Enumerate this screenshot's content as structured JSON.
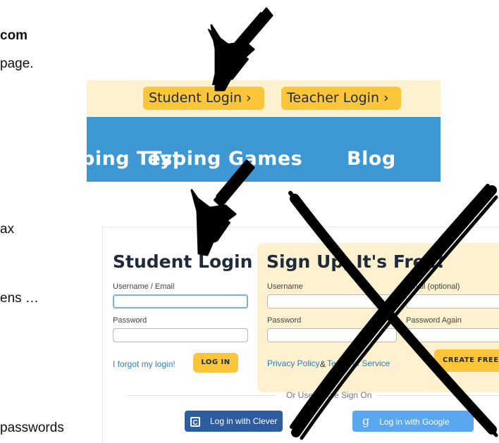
{
  "doc": {
    "line1": "com",
    "line2": "page.",
    "line3": "ax",
    "line4": "ens …",
    "line5": "passwords"
  },
  "topnav": {
    "student_login": "Student Login ›",
    "teacher_login": "Teacher Login ›",
    "links": [
      "ping Test",
      "Typing Games",
      "Blog"
    ]
  },
  "login": {
    "title": "Student Login",
    "username_label": "Username / Email",
    "password_label": "Password",
    "forgot_link": "I forgot my login!",
    "login_button": "LOG IN"
  },
  "signup": {
    "title": "Sign Up, It's Free!",
    "username_label": "Username",
    "email_label": "Email (optional)",
    "password_label": "Password",
    "password_again_label": "Password Again",
    "privacy_link": "Privacy Policy",
    "amp": "&",
    "terms_link": "Terms of Service",
    "create_button": "CREATE FREE AC"
  },
  "sso": {
    "label": "Or Use Single Sign On",
    "clever": "Log in with Clever",
    "google": "Log in with Google",
    "clever_color": "#2e5d9f",
    "google_color": "#5aa7f0"
  },
  "annotations": {
    "arrow_color": "#000000",
    "cross_color": "#000000"
  }
}
